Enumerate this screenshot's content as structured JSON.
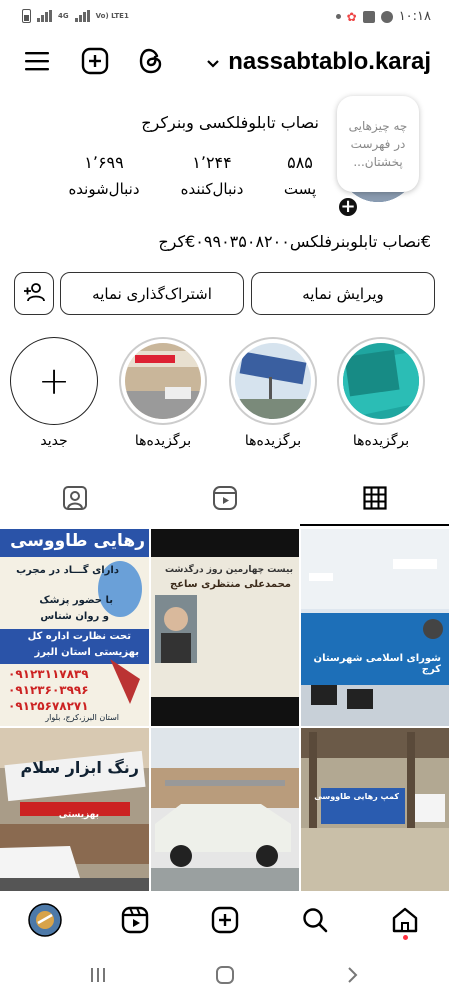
{
  "status_bar": {
    "network": "4G",
    "volte": "Vo) LTE1",
    "time": "۱۰:۱۸"
  },
  "header": {
    "username": "nassabtablo.karaj",
    "icons": [
      "menu-icon",
      "create-post-icon",
      "threads-icon",
      "chevron-down-icon"
    ]
  },
  "profile": {
    "display_name": "نصاب تابلوفلکسی وبنرکرج",
    "note": "چه چیزهایی در فهرست پخشتان...",
    "stats": {
      "posts_count": "۵۸۵",
      "posts_label": "پست",
      "followers_count": "۱٬۲۴۴",
      "followers_label": "دنبال‌کننده",
      "following_count": "۱٬۶۹۹",
      "following_label": "دنبال‌شونده"
    },
    "bio": "€نصاب تابلوبنرفلکس۰۹۹۰۳۵۰۸۲۰۰€کرج"
  },
  "buttons": {
    "edit_profile": "ویرایش نمایه",
    "share_profile": "اشتراک‌گذاری نمایه",
    "add_user_icon": "add-user-icon"
  },
  "highlights": [
    {
      "label": "برگزیده‌ها"
    },
    {
      "label": "برگزیده‌ها"
    },
    {
      "label": "برگزیده‌ها"
    },
    {
      "label": "جدید"
    }
  ],
  "tabs": [
    "grid-icon",
    "reels-icon",
    "tagged-icon"
  ],
  "grid_posts": {
    "post1_headline": "رهایی طاووسی",
    "post1_lines": [
      "دارای گـــاد در مجرب",
      "با حضور پزشک",
      "و روان شناس",
      "تحت نظارت اداره کل",
      "بهزیستی استان البرز"
    ],
    "post1_phones": [
      "۰۹۱۲۳۱۱۷۸۳۹",
      "۰۹۱۲۳۶۰۳۹۹۶",
      "۰۹۱۲۵۶۷۸۲۷۱"
    ],
    "post1_address": "استان البرز،کرج، بلوار",
    "post2_title": "بیست چهارمین روز درگذشت",
    "post2_name": "محمدعلی منتظری ساعج",
    "post3_sign": "شورای اسلامی شهرستان کرج",
    "post4_sign": "رنگ ابزار سلام",
    "post4_sub": "بهزیستی",
    "post6_banner": "کمپ رهایی طاووسی"
  },
  "bottom_nav": [
    "home-icon",
    "search-icon",
    "create-icon",
    "reels-icon",
    "profile-avatar"
  ],
  "colors": {
    "accent_red": "#ff3040",
    "text": "#000000",
    "border": "#333333"
  }
}
